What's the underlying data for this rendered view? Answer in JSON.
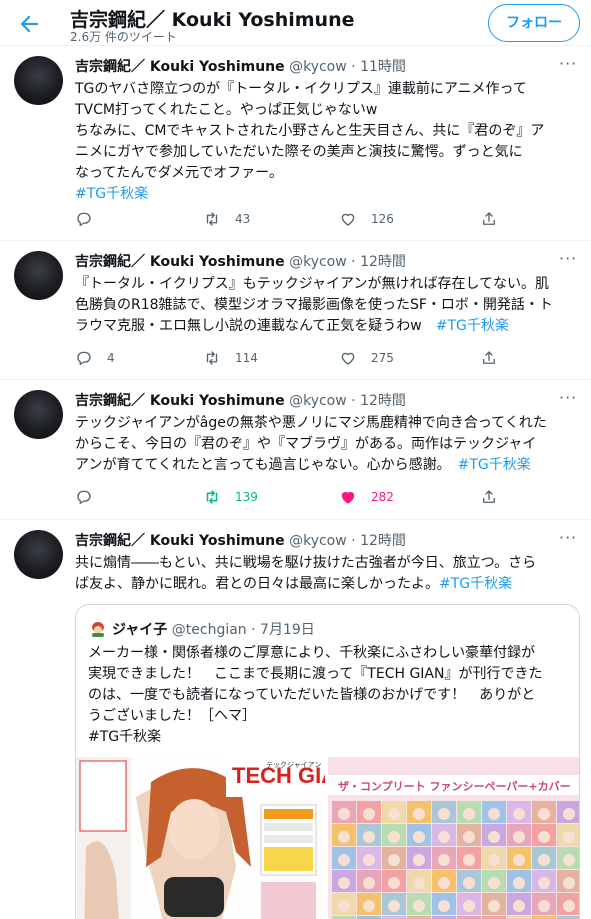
{
  "header": {
    "title": "吉宗鋼紀／ Kouki Yoshimune",
    "tweet_count": "2.6万 件のツイート",
    "follow_label": "フォロー"
  },
  "colors": {
    "accent": "#1d9bf0",
    "retweet_active": "#00ba7c",
    "like_active": "#f91880",
    "text_secondary": "#536471"
  },
  "tweets": [
    {
      "name": "吉宗鋼紀／ Kouki Yoshimune",
      "handle": "@kycow",
      "sep": "·",
      "time": "11時間",
      "text": "TGのヤバさ際立つのが『トータル・イクリプス』連載前にアニメ作って\nTVCM打ってくれたこと。やっぱ正気じゃないw\nちなみに、CMでキャストされた小野さんと生天目さん、共に『君のぞ』ア\nニメにガヤで参加していただいた際その美声と演技に驚愕。ずっと気に\nなってたんでダメ元でオファー。",
      "hashtag": "#TG千秋楽",
      "reply_count": "",
      "retweet_count": "43",
      "like_count": "126"
    },
    {
      "name": "吉宗鋼紀／ Kouki Yoshimune",
      "handle": "@kycow",
      "sep": "·",
      "time": "12時間",
      "text": "『トータル・イクリプス』もテックジャイアンが無ければ存在してない。肌\n色勝負のR18雑誌で、模型ジオラマ撮影画像を使ったSF・ロボ・開発話・ト\nラウマ克服・エロ無し小説の連載なんて正気を疑うわw　",
      "hashtag": "#TG千秋楽",
      "reply_count": "4",
      "retweet_count": "114",
      "like_count": "275"
    },
    {
      "name": "吉宗鋼紀／ Kouki Yoshimune",
      "handle": "@kycow",
      "sep": "·",
      "time": "12時間",
      "text": "テックジャイアンがâgeの無茶や悪ノリにマジ馬鹿精神で向き合ってくれた\nからこそ、今日の『君のぞ』や『マブラヴ』がある。両作はテックジャイ\nアンが育ててくれたと言っても過言じゃない。心から感謝。　",
      "hashtag": "#TG千秋楽",
      "reply_count": "",
      "retweet_count": "139",
      "like_count": "282"
    },
    {
      "name": "吉宗鋼紀／ Kouki Yoshimune",
      "handle": "@kycow",
      "sep": "·",
      "time": "12時間",
      "text": "共に煽情――もとい、共に戦場を駆け抜けた古強者が今日、旅立つ。さら\nば友よ、静かに眠れ。君との日々は最高に楽しかったよ。",
      "hashtag": "#TG千秋楽"
    }
  ],
  "quote": {
    "name": "ジャイ子",
    "handle": "@techgian",
    "sep": "·",
    "date": "7月19日",
    "text": "メーカー様・関係者様のご厚意により、千秋楽にふさわしい豪華付録が\n実現できました！　ここまで長期に渡って『TECH GIAN』が刊行できた\nのは、一度でも読者になっていただいた皆様のおかげです！　ありがと\nうございました！［ヘマ］\n#TG千秋楽",
    "cover_masthead": "TECH GIAN",
    "cover_sub": "テックジャイアン",
    "poster_title": "ザ・コンプリート ファンシーペーパー+カバー"
  }
}
